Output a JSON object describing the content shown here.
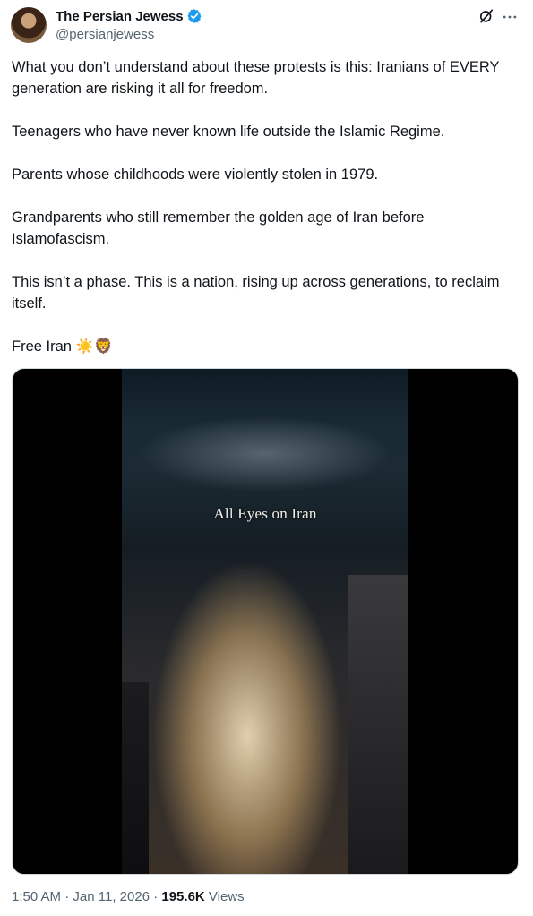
{
  "author": {
    "display_name": "The Persian Jewess",
    "handle": "@persianjewess",
    "verified": true
  },
  "icons": {
    "avatar": "avatar",
    "verified": "verified-badge-icon",
    "grok": "grok-icon",
    "more": "more-icon"
  },
  "tweet": {
    "paragraphs": [
      "What you don’t understand about these protests is this: Iranians of EVERY generation are risking it all for freedom.",
      "Teenagers who have never known life outside the Islamic Regime.",
      "Parents whose childhoods were violently stolen in 1979.",
      "Grandparents who still remember the golden age of Iran before Islamofascism.",
      "This isn’t a phase. This is a nation, rising up across generations, to reclaim itself.",
      "Free Iran ☀️🦁"
    ]
  },
  "media": {
    "caption": "All Eyes on Iran"
  },
  "meta": {
    "time": "1:50 AM",
    "separator1": " · ",
    "date": "Jan 11, 2026",
    "separator2": " · ",
    "views_count": "195.6K",
    "views_label": " Views"
  },
  "colors": {
    "text": "#0f1419",
    "secondary": "#536471",
    "verified_blue": "#1d9bf0"
  }
}
